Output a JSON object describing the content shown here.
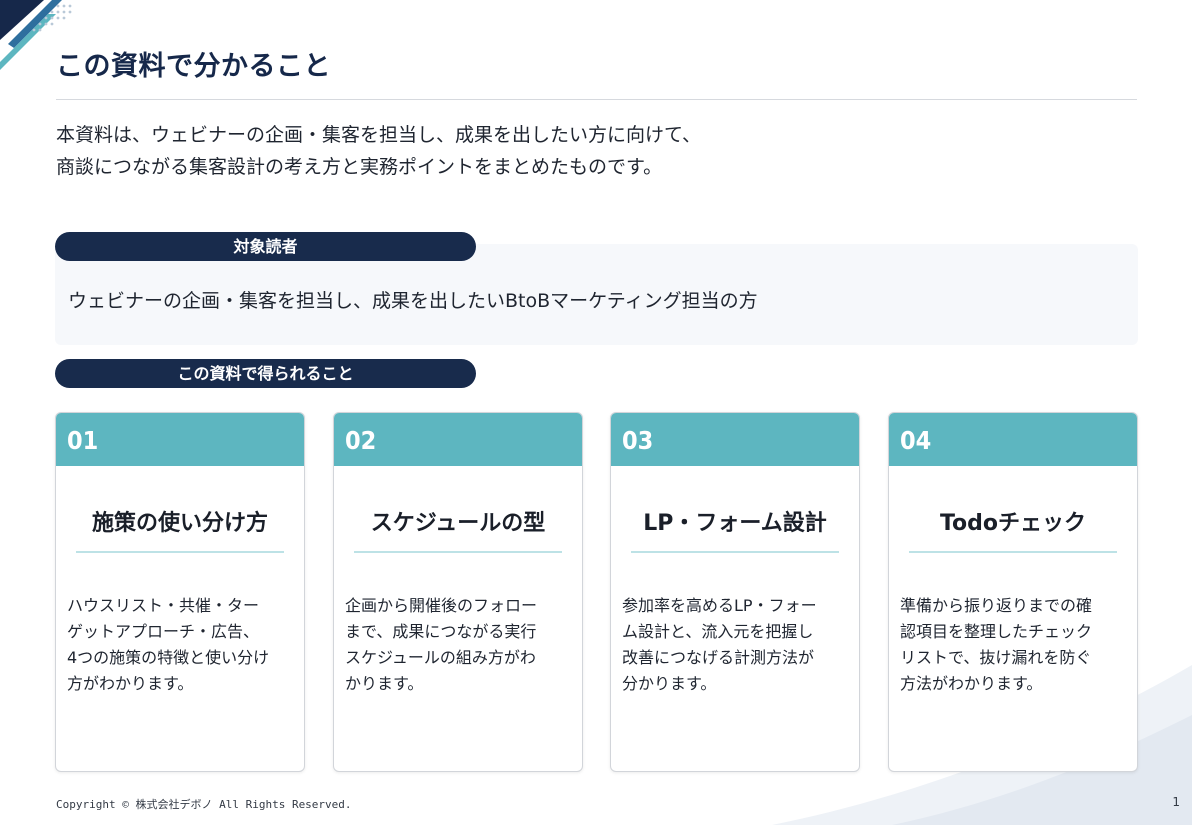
{
  "page": {
    "title": "この資料で分かること",
    "intro": [
      "本資料は、ウェビナーの企画・集客を担当し、成果を出したい方に向けて、",
      "商談につながる集客設計の考え方と実務ポイントをまとめたものです。"
    ]
  },
  "audience": {
    "label": "対象読者",
    "text": "ウェビナーの企画・集客を担当し、成果を出したいBtoBマーケティング担当の方"
  },
  "benefits": {
    "label": "この資料で得られること",
    "cards": [
      {
        "number": "01",
        "title": "施策の使い分け方",
        "lines": [
          "ハウスリスト・共催・ター",
          "ゲットアプローチ・広告、",
          "4つの施策の特徴と使い分け",
          "方がわかります。"
        ]
      },
      {
        "number": "02",
        "title": "スケジュールの型",
        "lines": [
          "企画から開催後のフォロー",
          "まで、成果につながる実行",
          "スケジュールの組み方がわ",
          "かります。"
        ]
      },
      {
        "number": "03",
        "title": "LP・フォーム設計",
        "lines": [
          "参加率を高めるLP・フォー",
          "ム設計と、流入元を把握し",
          "改善につなげる計測方法が",
          "分かります。"
        ]
      },
      {
        "number": "04",
        "title": "Todoチェック",
        "lines": [
          "準備から振り返りまでの確",
          "認項目を整理したチェック",
          "リストで、抜け漏れを防ぐ",
          "方法がわかります。"
        ]
      }
    ]
  },
  "footer": {
    "copyright": "Copyright © 株式会社デボノ All Rights Reserved.",
    "page_number": "1"
  },
  "colors": {
    "navy": "#182b4c",
    "teal": "#5db6c0",
    "light_teal": "#bde2e6",
    "panel_bg": "#f6f8fb"
  }
}
